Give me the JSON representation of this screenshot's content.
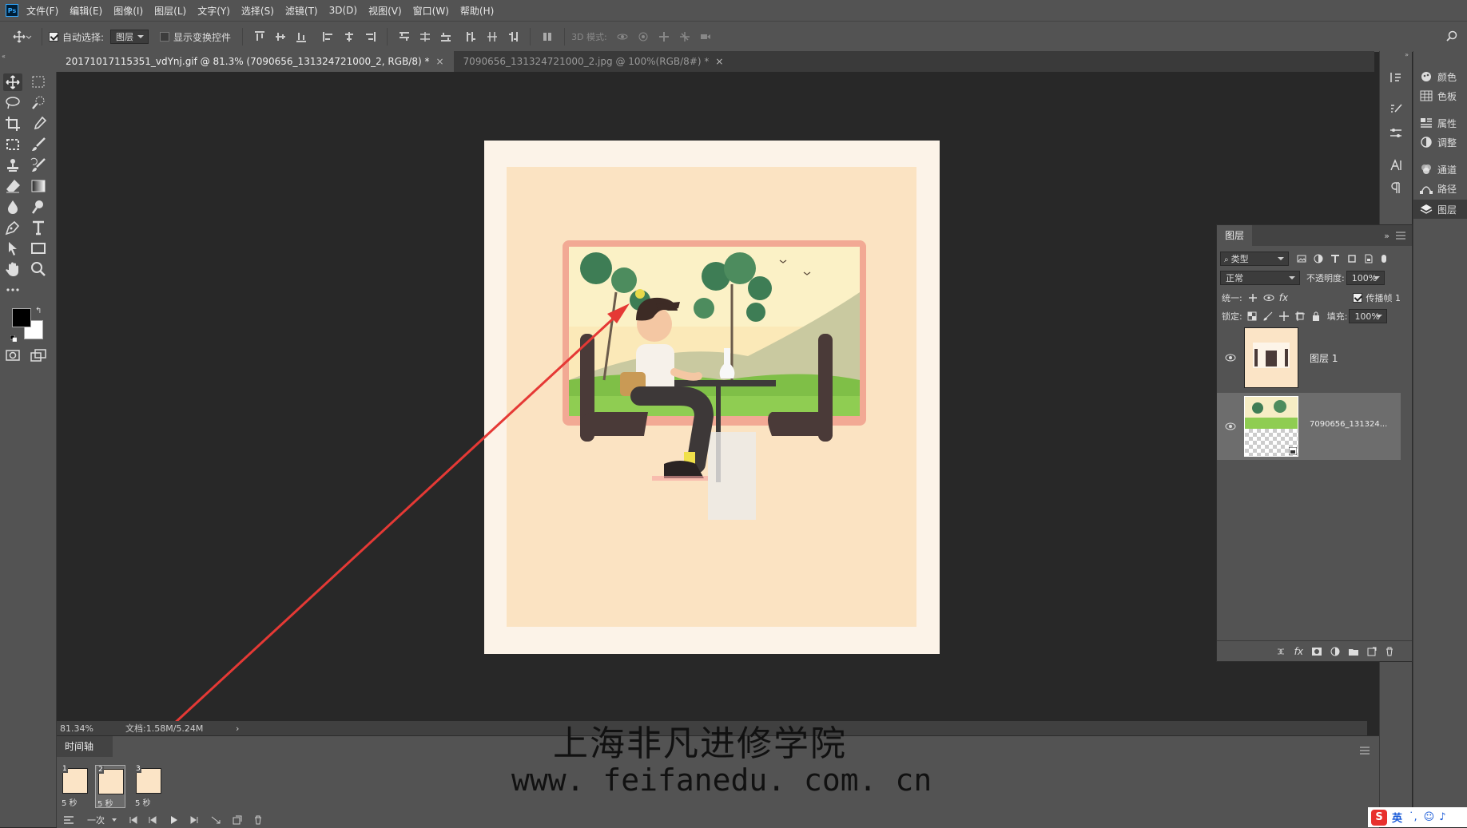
{
  "menu": {
    "logo": "Ps",
    "items": [
      "文件(F)",
      "编辑(E)",
      "图像(I)",
      "图层(L)",
      "文字(Y)",
      "选择(S)",
      "滤镜(T)",
      "3D(D)",
      "视图(V)",
      "窗口(W)",
      "帮助(H)"
    ]
  },
  "options": {
    "auto_select_label": "自动选择:",
    "auto_select_value": "图层",
    "show_transform_label": "显示变换控件",
    "mode_3d_label": "3D 模式:"
  },
  "tabs": [
    {
      "label": "20171017115351_vdYnj.gif @ 81.3% (7090656_131324721000_2, RGB/8) *",
      "close": "×"
    },
    {
      "label": "7090656_131324721000_2.jpg @ 100%(RGB/8#) *",
      "close": "×"
    }
  ],
  "status": {
    "zoom": "81.34%",
    "doc": "文档:1.58M/5.24M",
    "arrow": "›"
  },
  "timeline": {
    "title": "时间轴",
    "loop": "一次",
    "frames": [
      {
        "num": "1",
        "delay": "5 秒"
      },
      {
        "num": "2",
        "delay": "5 秒"
      },
      {
        "num": "3",
        "delay": "5 秒"
      }
    ]
  },
  "right_panel": {
    "items": [
      {
        "icon": "color-icon",
        "label": "颜色"
      },
      {
        "icon": "swatches-icon",
        "label": "色板"
      },
      {
        "icon": "properties-icon",
        "label": "属性"
      },
      {
        "icon": "adjustments-icon",
        "label": "调整"
      },
      {
        "icon": "channels-icon",
        "label": "通道"
      },
      {
        "icon": "paths-icon",
        "label": "路径"
      },
      {
        "icon": "layers-icon",
        "label": "图层"
      }
    ]
  },
  "layers": {
    "tab": "图层",
    "filter": "类型",
    "blend_mode": "正常",
    "opacity_label": "不透明度:",
    "opacity_value": "100%",
    "unify_label": "统一:",
    "propagate_label": "传播帧 1",
    "lock_label": "锁定:",
    "fill_label": "填充:",
    "fill_value": "100%",
    "rows": [
      {
        "name": "图层 1"
      },
      {
        "name": "7090656_131324..."
      }
    ]
  },
  "watermark": {
    "line1": "上海非凡进修学院",
    "line2": "www. feifanedu. com. cn"
  },
  "ime": {
    "brand": "S",
    "lang": "英"
  },
  "colors": {
    "panel": "#535353",
    "canvas_bg": "#282828",
    "accent": "#31a8ff",
    "annotation_red": "#e53935"
  }
}
